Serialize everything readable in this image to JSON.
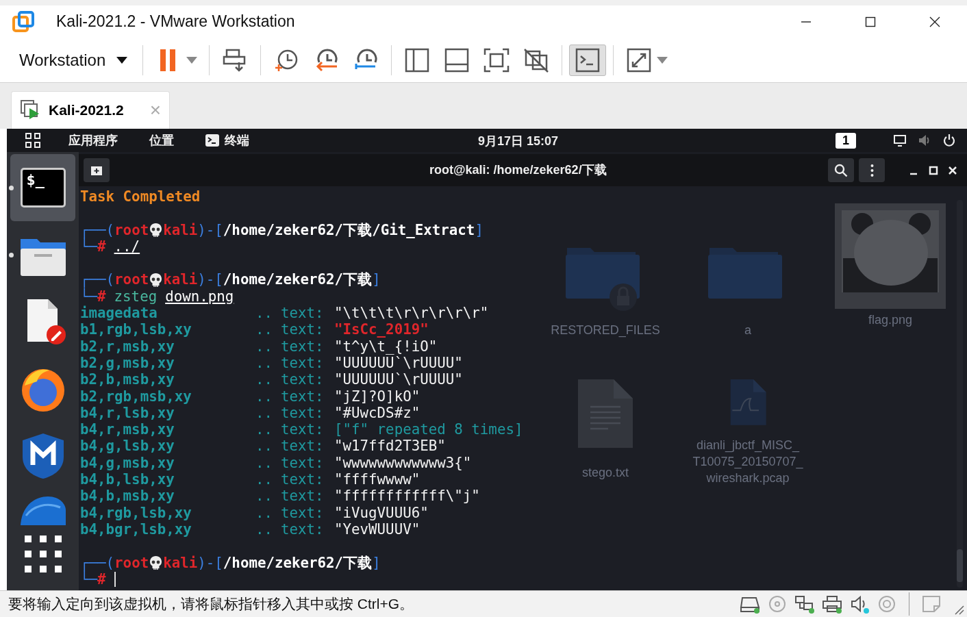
{
  "window": {
    "title": "Kali-2021.2 - VMware Workstation"
  },
  "toolbar": {
    "menu_label": "Workstation",
    "tools": [
      {
        "kind": "pause",
        "pressed": false,
        "dropdown": true
      },
      {
        "kind": "send-keys",
        "pressed": false,
        "dropdown": false
      },
      {
        "kind": "snapshot-take",
        "pressed": false,
        "dropdown": false
      },
      {
        "kind": "snapshot-revert",
        "pressed": false,
        "dropdown": false
      },
      {
        "kind": "snapshot-manage",
        "pressed": false,
        "dropdown": false
      },
      {
        "kind": "view-library",
        "pressed": false,
        "dropdown": false
      },
      {
        "kind": "view-thumbnail",
        "pressed": false,
        "dropdown": false
      },
      {
        "kind": "fullscreen",
        "pressed": false,
        "dropdown": false
      },
      {
        "kind": "unity",
        "pressed": false,
        "dropdown": false
      },
      {
        "kind": "console",
        "pressed": true,
        "dropdown": false
      },
      {
        "kind": "stretch",
        "pressed": false,
        "dropdown": true
      }
    ]
  },
  "tabs": [
    {
      "label": "Kali-2021.2",
      "close": "×",
      "selected": true
    }
  ],
  "guest": {
    "topbar": {
      "menus": [
        {
          "label": "应用程序",
          "kind": "menu"
        },
        {
          "label": "位置",
          "kind": "menu"
        },
        {
          "label": "终端",
          "kind": "terminal"
        }
      ],
      "clock": "9月17日 15:07",
      "workspace": "1"
    },
    "dock": [
      {
        "kind": "terminal",
        "glyph": "$_",
        "running": true,
        "selected": true
      },
      {
        "kind": "files",
        "running": true,
        "selected": false
      },
      {
        "kind": "editor",
        "running": false,
        "selected": false
      },
      {
        "kind": "browser",
        "running": false,
        "selected": false
      },
      {
        "kind": "shield",
        "running": false,
        "selected": false
      },
      {
        "kind": "dome",
        "running": false,
        "selected": false
      },
      {
        "kind": "app-grid",
        "running": false,
        "selected": false
      }
    ],
    "desktop_items": [
      {
        "kind": "locked-folder",
        "label": "RESTORED_FILES"
      },
      {
        "kind": "folder",
        "label": "a"
      },
      {
        "kind": "picture",
        "label": "flag.png"
      },
      {
        "kind": "text-file",
        "label": "stego.txt"
      },
      {
        "kind": "capture-file",
        "label": "dianli_jbctf_MISC_ T10075_20150707_ wireshark.pcap"
      }
    ],
    "terminal": {
      "title": "root@kali: /home/zeker62/下载",
      "lines": [
        {
          "kind": "notice",
          "text": "Task Completed"
        },
        {
          "kind": "prompt",
          "open": "┌──(",
          "user": "root",
          "host": "kali",
          "mid": ")-[",
          "path": "/home/zeker62/下载/Git_Extract",
          "close": "]",
          "branch": "└─",
          "sigil": "#",
          "argument": "../",
          "cursor": false
        },
        {
          "kind": "prompt",
          "open": "┌──(",
          "user": "root",
          "host": "kali",
          "mid": ")-[",
          "path": "/home/zeker62/下载",
          "close": "]",
          "branch": "└─",
          "sigil": "#",
          "command": "zsteg",
          "argument": "down.png",
          "cursor": false
        },
        {
          "kind": "output",
          "channel": "imagedata",
          "sep": "..",
          "label": "text:",
          "value": {
            "kind": "string",
            "text": "\"\\t\\t\\t\\r\\r\\r\\r\\r\""
          }
        },
        {
          "kind": "output",
          "channel": "b1,rgb,lsb,xy",
          "sep": "..",
          "label": "text:",
          "value": {
            "kind": "alert",
            "text": "\"IsCc_2019\""
          }
        },
        {
          "kind": "output",
          "channel": "b2,r,msb,xy",
          "sep": "..",
          "label": "text:",
          "value": {
            "kind": "string",
            "text": "\"t^y\\t_{!iO\""
          }
        },
        {
          "kind": "output",
          "channel": "b2,g,msb,xy",
          "sep": "..",
          "label": "text:",
          "value": {
            "kind": "string",
            "text": "\"UUUUUU`\\rUUUU\""
          }
        },
        {
          "kind": "output",
          "channel": "b2,b,msb,xy",
          "sep": "..",
          "label": "text:",
          "value": {
            "kind": "string",
            "text": "\"UUUUUU`\\rUUUU\""
          }
        },
        {
          "kind": "output",
          "channel": "b2,rgb,msb,xy",
          "sep": "..",
          "label": "text:",
          "value": {
            "kind": "string",
            "text": "\"jZ]?O]kO\""
          }
        },
        {
          "kind": "output",
          "channel": "b4,r,lsb,xy",
          "sep": "..",
          "label": "text:",
          "value": {
            "kind": "string",
            "text": "\"#UwcDS#z\""
          }
        },
        {
          "kind": "output",
          "channel": "b4,r,msb,xy",
          "sep": "..",
          "label": "text:",
          "value": {
            "kind": "note",
            "text": "[\"f\" repeated 8 times]"
          }
        },
        {
          "kind": "output",
          "channel": "b4,g,lsb,xy",
          "sep": "..",
          "label": "text:",
          "value": {
            "kind": "string",
            "text": "\"w17ffd2T3EB\""
          }
        },
        {
          "kind": "output",
          "channel": "b4,g,msb,xy",
          "sep": "..",
          "label": "text:",
          "value": {
            "kind": "string",
            "text": "\"wwwwwwwwwwww3{\""
          }
        },
        {
          "kind": "output",
          "channel": "b4,b,lsb,xy",
          "sep": "..",
          "label": "text:",
          "value": {
            "kind": "string",
            "text": "\"ffffwwww\""
          }
        },
        {
          "kind": "output",
          "channel": "b4,b,msb,xy",
          "sep": "..",
          "label": "text:",
          "value": {
            "kind": "string",
            "text": "\"ffffffffffff\\\"j\""
          }
        },
        {
          "kind": "output",
          "channel": "b4,rgb,lsb,xy",
          "sep": "..",
          "label": "text:",
          "value": {
            "kind": "string",
            "text": "\"iVugVUUU6\""
          }
        },
        {
          "kind": "output",
          "channel": "b4,bgr,lsb,xy",
          "sep": "..",
          "label": "text:",
          "value": {
            "kind": "string",
            "text": "\"YevWUUUV\""
          }
        },
        {
          "kind": "prompt",
          "open": "┌──(",
          "user": "root",
          "host": "kali",
          "mid": ")-[",
          "path": "/home/zeker62/下载",
          "close": "]",
          "branch": "└─",
          "sigil": "#",
          "cursor": true
        }
      ]
    }
  },
  "status_bar": {
    "message": "要将输入定向到该虚拟机，请将鼠标指针移入其中或按 Ctrl+G。",
    "devices": [
      {
        "kind": "disk",
        "active": true,
        "color": "#4caf50"
      },
      {
        "kind": "optical",
        "active": false
      },
      {
        "kind": "network",
        "active": true,
        "color": "#4caf50"
      },
      {
        "kind": "printer",
        "active": true,
        "color": "#4caf50"
      },
      {
        "kind": "sound",
        "active": true,
        "color": "#26c6da"
      },
      {
        "kind": "disc",
        "active": false
      },
      {
        "kind": "message",
        "active": false
      }
    ]
  }
}
